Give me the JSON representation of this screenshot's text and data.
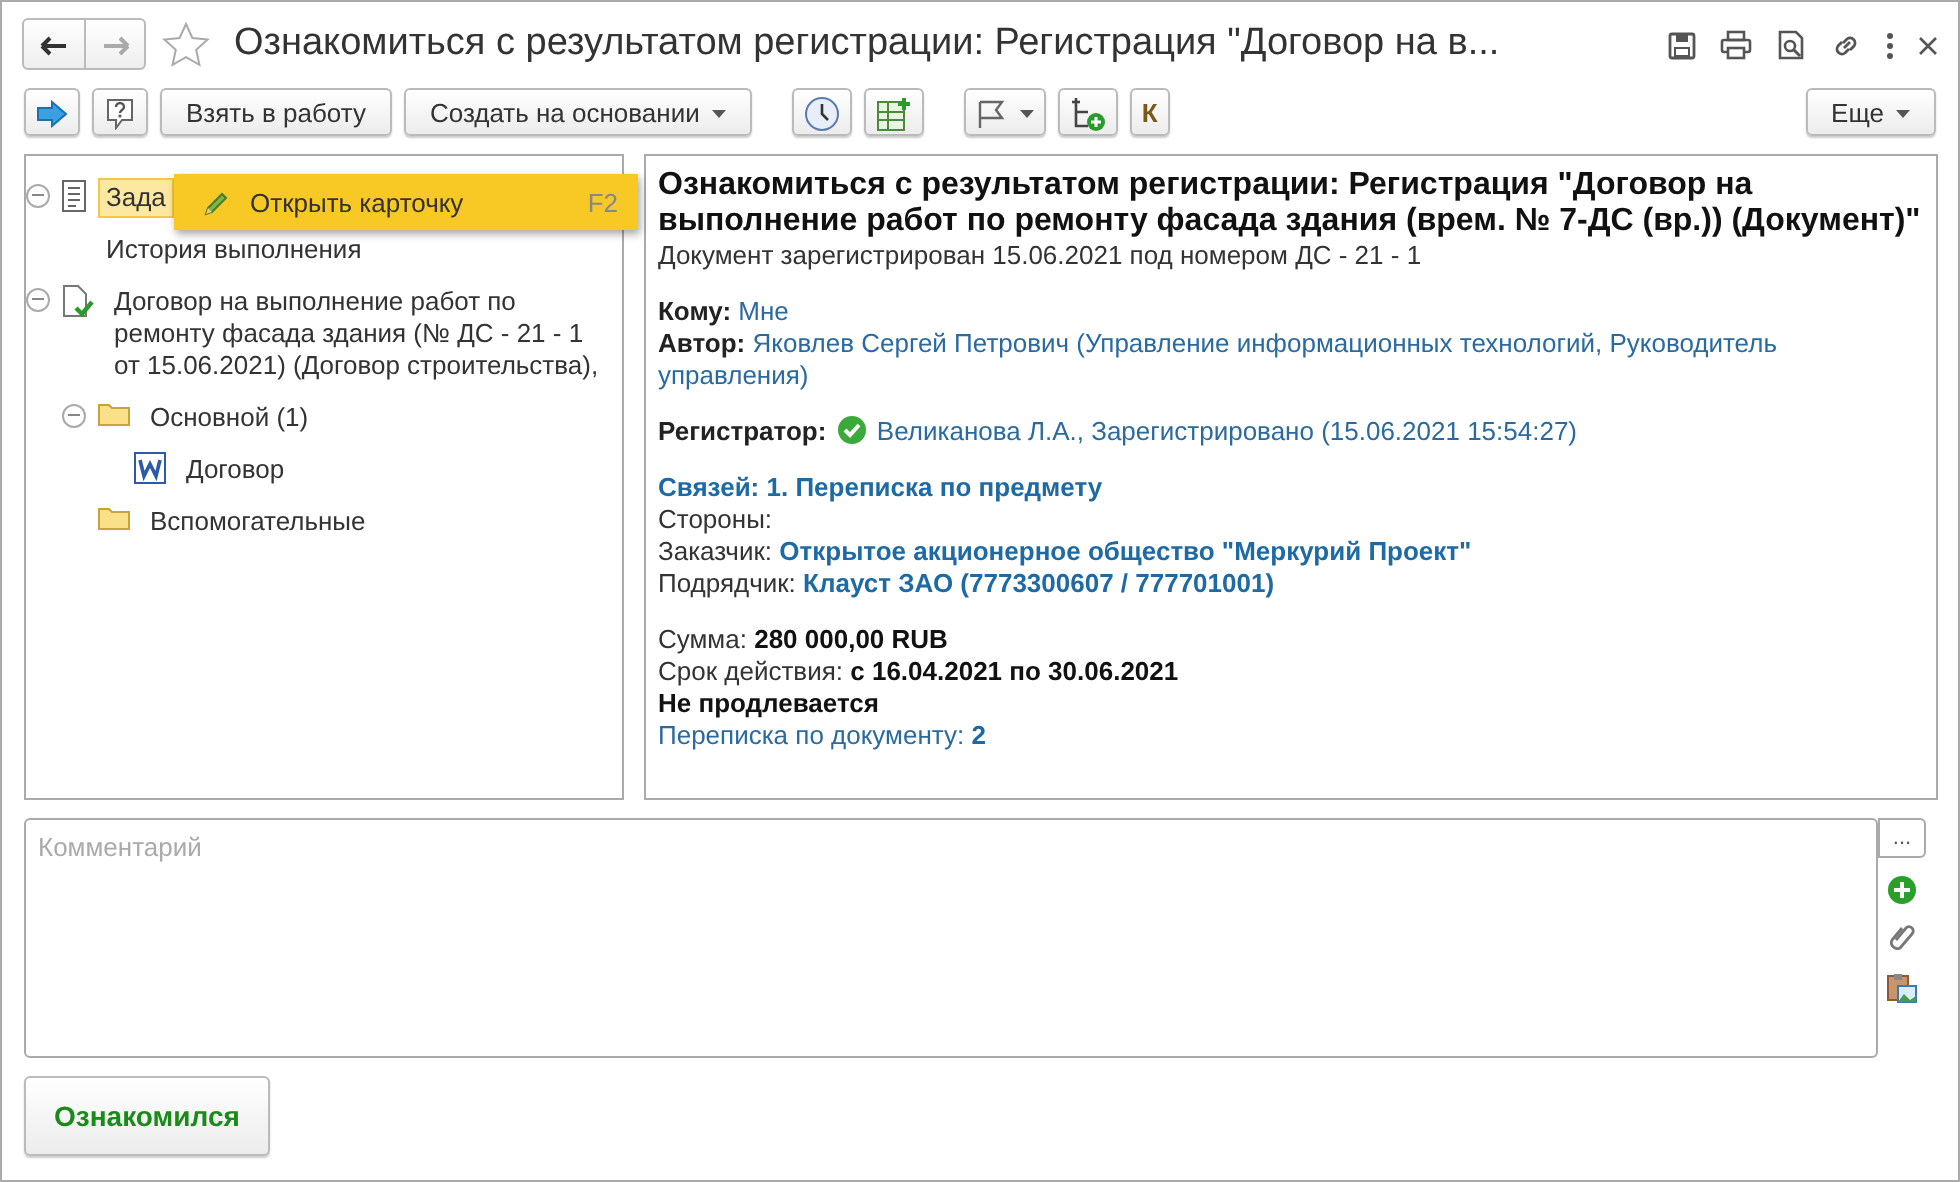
{
  "window": {
    "title": "Ознакомиться с результатом регистрации: Регистрация \"Договор  на  в...",
    "favorite": false
  },
  "toolbar": [
    {
      "kind": "icon"
    },
    {
      "kind": "icon"
    },
    {
      "kind": "button",
      "label": "Взять в работу"
    },
    {
      "kind": "dropdown",
      "label": "Создать на основании"
    },
    {
      "kind": "icon"
    },
    {
      "kind": "icon"
    },
    {
      "kind": "dropdown"
    },
    {
      "kind": "icon"
    },
    {
      "kind": "letter",
      "text": "К"
    }
  ],
  "more_button": {
    "label": "Еще"
  },
  "tree": [
    {
      "kind": "task",
      "label": "Зада",
      "selected": true,
      "expanded": true,
      "children": [
        {
          "kind": "plain",
          "label": "История выполнения",
          "selected": false
        }
      ]
    },
    {
      "kind": "doc",
      "label": "Договор  на  выполнение работ по ремонту фасада здания (№ ДС - 21 - 1 от 15.06.2021) (Договор строительства),",
      "selected": false,
      "expanded": true,
      "children": [
        {
          "kind": "folder",
          "label": "Основной (1)",
          "selected": false,
          "expanded": true,
          "children": [
            {
              "kind": "word",
              "label": "Договор",
              "selected": false
            }
          ]
        },
        {
          "kind": "folder",
          "label": "Вспомогательные",
          "selected": false
        }
      ]
    }
  ],
  "context_menu": {
    "items": [
      {
        "label": "Открыть карточку",
        "shortcut": "F2",
        "selected": true
      }
    ]
  },
  "details": {
    "heading": "Ознакомиться с результатом регистрации: Регистрация \"Договор  на выполнение работ по ремонту фасада здания (врем. № 7-ДС (вр.)) (Документ)\"",
    "lines": [
      [
        {
          "kind": "plain",
          "text": "Документ зарегистрирован 15.06.2021 под номером ДС - 21 - 1"
        }
      ],
      [
        {
          "kind": "gap"
        }
      ],
      [
        {
          "kind": "label",
          "text": "Кому:"
        },
        {
          "kind": "link",
          "text": "Мне"
        }
      ],
      [
        {
          "kind": "label",
          "text": "Автор:"
        },
        {
          "kind": "link",
          "text": "Яковлев Сергей Петрович (Управление информационных технологий, Руководитель"
        }
      ],
      [
        {
          "kind": "link",
          "text": "управления)"
        }
      ],
      [
        {
          "kind": "gap"
        }
      ],
      [
        {
          "kind": "label",
          "text": "Регистратор:"
        },
        {
          "kind": "check"
        },
        {
          "kind": "link",
          "text": "Великанова Л.А., Зарегистрировано (15.06.2021 15:54:27)"
        }
      ],
      [
        {
          "kind": "gap"
        }
      ],
      [
        {
          "kind": "link_bold",
          "text": "Связей: 1. Переписка по предмету"
        }
      ],
      [
        {
          "kind": "plain",
          "text": "Стороны:"
        }
      ],
      [
        {
          "kind": "plain",
          "text": "Заказчик:"
        },
        {
          "kind": "link_bold",
          "text": "Открытое акционерное общество \"Меркурий Проект\""
        }
      ],
      [
        {
          "kind": "plain",
          "text": "Подрядчик:"
        },
        {
          "kind": "link_bold",
          "text": "Клауст ЗАО (7773300607 / 777701001)"
        }
      ],
      [
        {
          "kind": "gap"
        }
      ],
      [
        {
          "kind": "plain",
          "text": "Сумма:"
        },
        {
          "kind": "bold",
          "text": "280 000,00 RUB"
        }
      ],
      [
        {
          "kind": "plain",
          "text": "Срок действия:"
        },
        {
          "kind": "bold",
          "text": "с 16.04.2021 по 30.06.2021"
        }
      ],
      [
        {
          "kind": "bold",
          "text": "Не продлевается"
        }
      ],
      [
        {
          "kind": "link",
          "text": "Переписка по документу:"
        },
        {
          "kind": "link_bold",
          "text": "2"
        }
      ]
    ]
  },
  "comment": {
    "placeholder": "Комментарий",
    "more": "..."
  },
  "submit": {
    "label": "Ознакомился"
  }
}
